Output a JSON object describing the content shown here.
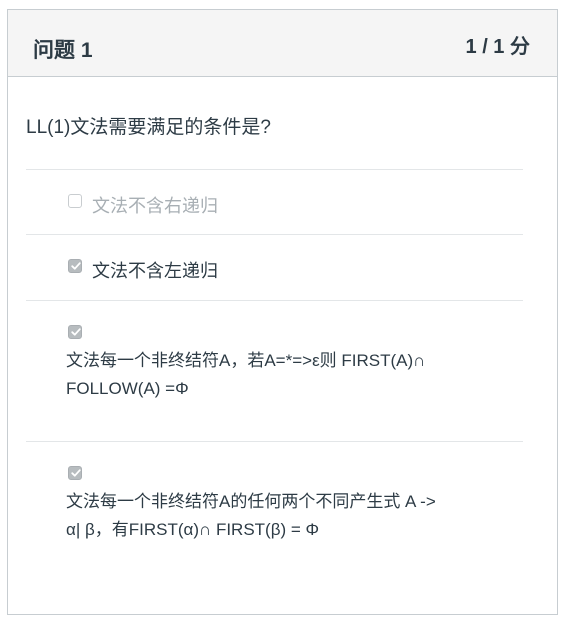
{
  "question": {
    "title": "问题 1",
    "score": "1 / 1 分",
    "text": "LL(1)文法需要满足的条件是?"
  },
  "answers": [
    {
      "label": "文法不含右递归",
      "checked": false
    },
    {
      "label": "文法不含左递归",
      "checked": true
    },
    {
      "line1": "文法每一个非终结符A，若A=*=>ε则 FIRST(A)∩",
      "line2": "FOLLOW(A) =Φ",
      "checked": true
    },
    {
      "line1": "文法每一个非终结符A的任何两个不同产生式 A ->",
      "line2": "α| β，有FIRST(α)∩ FIRST(β) = Φ",
      "checked": true
    }
  ],
  "icons": {
    "checkbox": "checkbox-icon",
    "checkmark": "checkmark-icon"
  },
  "colors": {
    "text": "#2d3b45",
    "muted": "#a8afb4",
    "header_bg": "#f5f5f5",
    "border": "#c7cdd1"
  }
}
